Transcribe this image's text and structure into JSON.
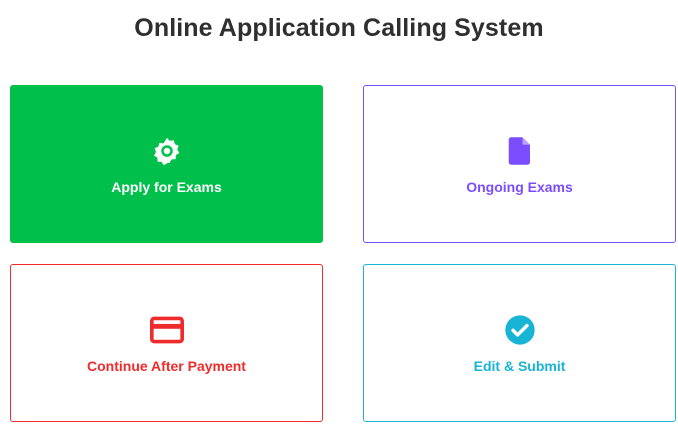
{
  "header": {
    "title": "Online Application Calling System"
  },
  "cards": [
    {
      "label": "Apply for Exams",
      "icon": "gear-icon",
      "color": "#00c04b",
      "style": "filled"
    },
    {
      "label": "Ongoing Exams",
      "icon": "document-icon",
      "color": "#7c4dff",
      "style": "outlined"
    },
    {
      "label": "Continue After Payment",
      "icon": "credit-card-icon",
      "color": "#ef2b2b",
      "style": "outlined"
    },
    {
      "label": "Edit & Submit",
      "icon": "check-circle-icon",
      "color": "#17b4d6",
      "style": "outlined"
    }
  ]
}
